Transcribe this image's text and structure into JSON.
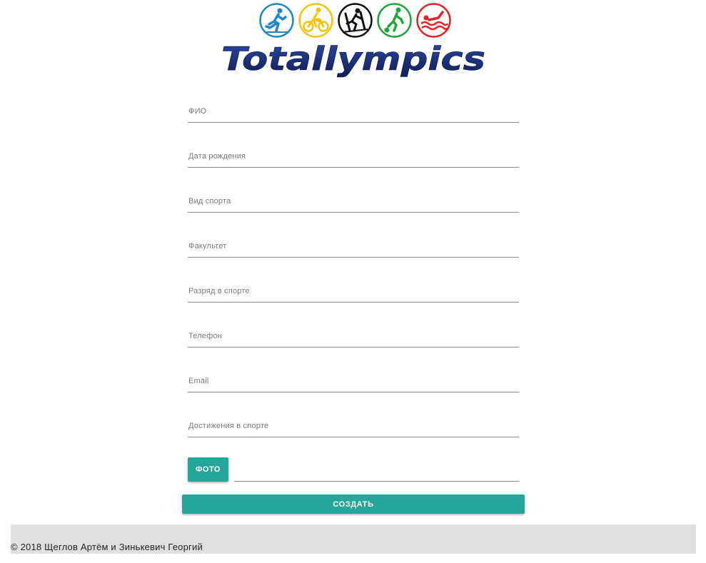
{
  "header": {
    "logo_text": "Totallympics",
    "sport_icons": [
      {
        "name": "running-icon",
        "color": "#1e88c7"
      },
      {
        "name": "cycling-icon",
        "color": "#f2c40f"
      },
      {
        "name": "skiing-icon",
        "color": "#111111"
      },
      {
        "name": "football-icon",
        "color": "#1fa53a"
      },
      {
        "name": "swimming-icon",
        "color": "#e02424"
      }
    ]
  },
  "form": {
    "fields": [
      {
        "label": "ФИО",
        "value": ""
      },
      {
        "label": "Дата рождения",
        "value": ""
      },
      {
        "label": "Вид спорта",
        "value": ""
      },
      {
        "label": "Факультет",
        "value": ""
      },
      {
        "label": "Разряд в спорте",
        "value": ""
      },
      {
        "label": "Телефон",
        "value": ""
      },
      {
        "label": "Email",
        "value": ""
      },
      {
        "label": "Достижения в спорте",
        "value": ""
      }
    ],
    "photo_button": "ФОТО",
    "photo_path": "",
    "submit_button": "СОЗДАТЬ"
  },
  "footer": {
    "copyright": "© 2018 Щеглов Артём и Зинькевич Георгий"
  },
  "colors": {
    "accent": "#26a69a",
    "footer_bg": "#e0e0e0",
    "logo_blue": "#1a2f7a"
  }
}
